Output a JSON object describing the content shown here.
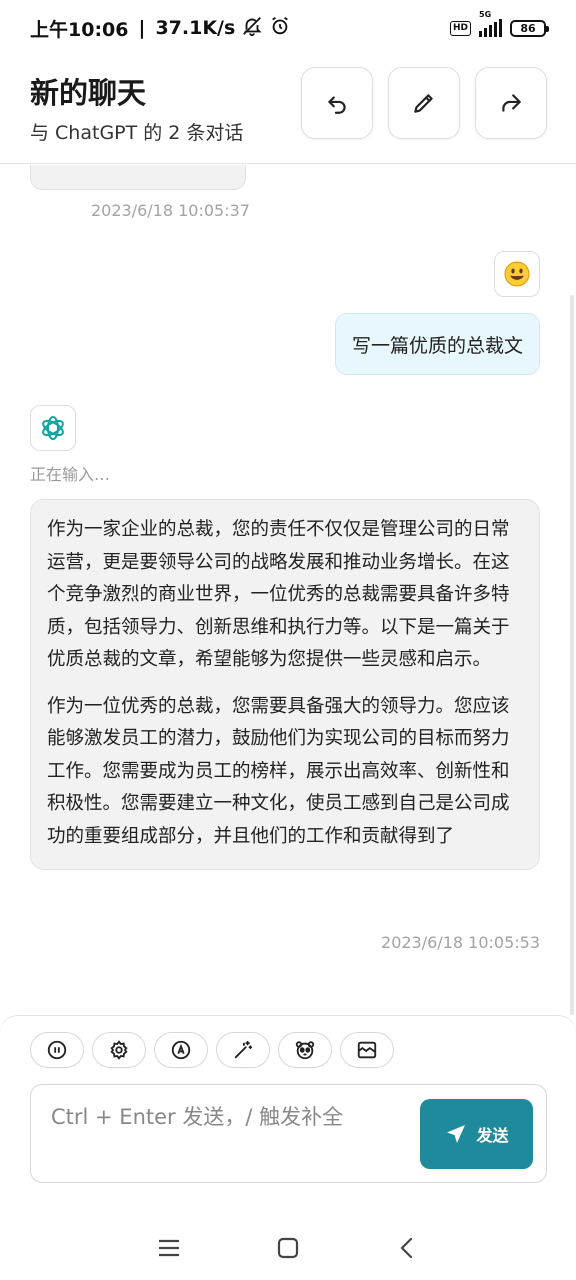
{
  "status_bar": {
    "time": "上午10:06",
    "speed": "37.1K/s",
    "hd": "HD",
    "network": "5G",
    "battery": "86"
  },
  "header": {
    "title": "新的聊天",
    "subtitle": "与 ChatGPT 的 2 条对话"
  },
  "messages": {
    "previous_time": "2023/6/18 10:05:37",
    "user_text": "写一篇优质的总裁文",
    "typing": "正在输入…",
    "bot_paragraphs": [
      "作为一家企业的总裁，您的责任不仅仅是管理公司的日常运营，更是要领导公司的战略发展和推动业务增长。在这个竞争激烈的商业世界，一位优秀的总裁需要具备许多特质，包括领导力、创新思维和执行力等。以下是一篇关于优质总裁的文章，希望能够为您提供一些灵感和启示。",
      "作为一位优秀的总裁，您需要具备强大的领导力。您应该能够激发员工的潜力，鼓励他们为实现公司的目标而努力工作。您需要成为员工的榜样，展示出高效率、创新性和积极性。您需要建立一种文化，使员工感到自己是公司成功的重要组成部分，并且他们的工作和贡献得到了"
    ],
    "bot_time": "2023/6/18 10:05:53"
  },
  "composer": {
    "placeholder": "Ctrl + Enter 发送，/ 触发补全",
    "send_label": "发送"
  },
  "colors": {
    "accent": "#1f8a9b",
    "user_bubble": "#e8f7fb",
    "bot_bubble": "#f2f2f2"
  }
}
